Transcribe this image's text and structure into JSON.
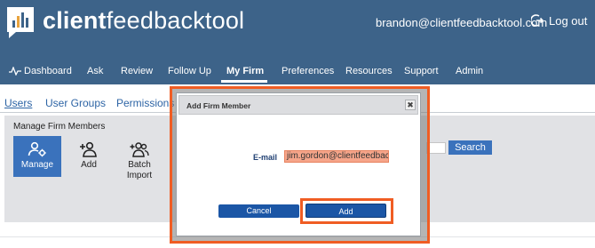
{
  "header": {
    "logo_bold": "client",
    "logo_light": "feedbacktool",
    "user_email": "brandon@clientfeedbacktool.com",
    "logout_label": "Log out"
  },
  "nav": {
    "items": [
      {
        "label": "Dashboard"
      },
      {
        "label": "Ask"
      },
      {
        "label": "Review"
      },
      {
        "label": "Follow Up"
      },
      {
        "label": "My Firm",
        "active": true
      },
      {
        "label": "Preferences"
      },
      {
        "label": "Resources"
      },
      {
        "label": "Support"
      },
      {
        "label": "Admin"
      }
    ]
  },
  "subtabs": [
    {
      "label": "Users",
      "active": true
    },
    {
      "label": "User Groups"
    },
    {
      "label": "Permissions"
    }
  ],
  "manage": {
    "title": "Manage Firm Members",
    "tools": [
      {
        "label": "Manage",
        "icon": "users-cog-icon",
        "active": true
      },
      {
        "label": "Add",
        "icon": "user-plus-icon"
      },
      {
        "label": "Batch",
        "label2": "Import",
        "icon": "users-plus-icon"
      }
    ],
    "search_label": "Search"
  },
  "modal": {
    "title": "Add Firm Member",
    "close_label": "✖",
    "email_label": "E-mail",
    "email_value": "jim.gordon@clientfeedbacktool.",
    "cancel_label": "Cancel",
    "add_label": "Add"
  },
  "colors": {
    "header_bg": "#3d6389",
    "accent_blue": "#3a72bc",
    "highlight": "#f05d23",
    "field_highlight": "#f6a58a"
  }
}
